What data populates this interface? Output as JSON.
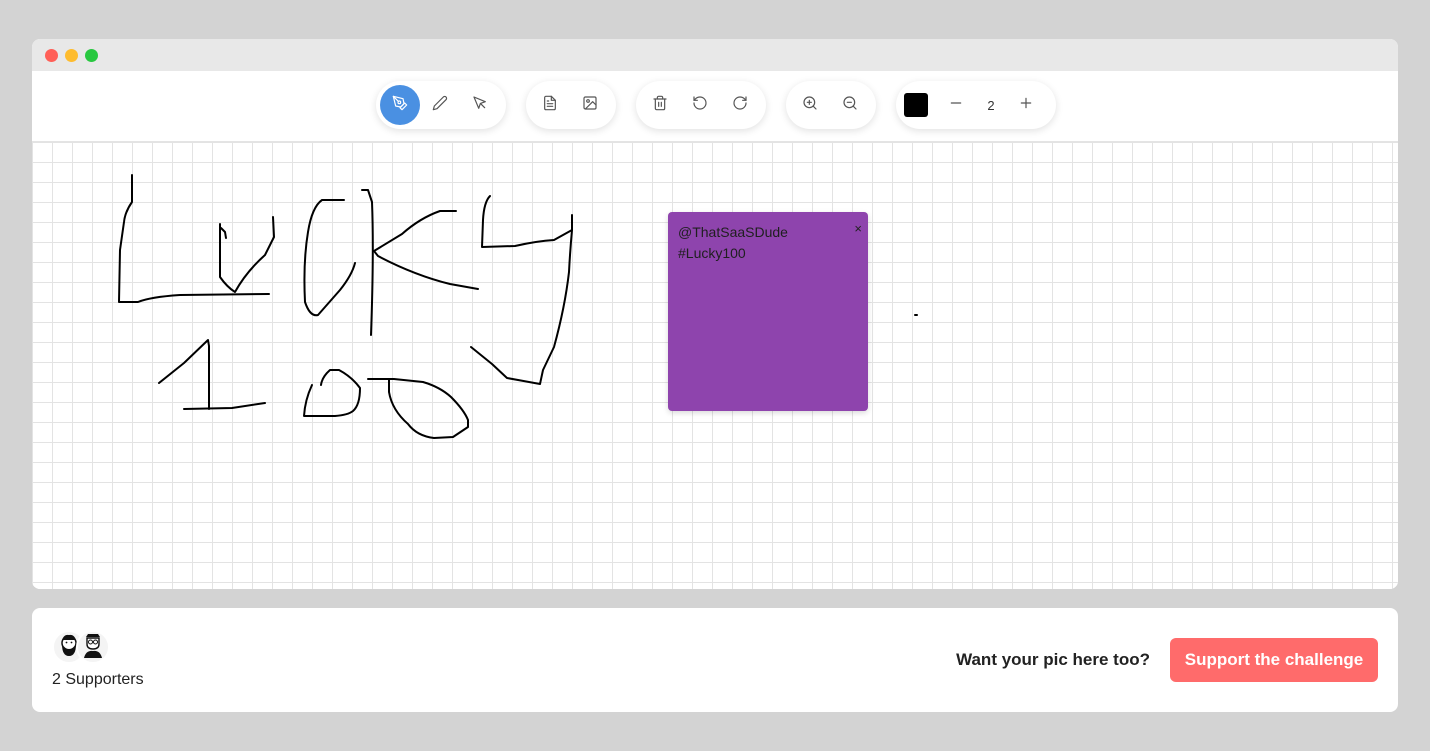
{
  "window": {
    "controls": [
      "close",
      "minimize",
      "maximize"
    ]
  },
  "toolbar": {
    "groups": [
      [
        {
          "name": "pen-tool",
          "icon": "pen-nib-icon",
          "active": true
        },
        {
          "name": "pencil-tool",
          "icon": "pencil-icon",
          "active": false
        },
        {
          "name": "select-tool",
          "icon": "cursor-arrow-icon",
          "active": false
        }
      ],
      [
        {
          "name": "add-note",
          "icon": "document-icon"
        },
        {
          "name": "add-image",
          "icon": "image-icon"
        }
      ],
      [
        {
          "name": "delete",
          "icon": "trash-icon"
        },
        {
          "name": "undo",
          "icon": "undo-icon"
        },
        {
          "name": "redo",
          "icon": "redo-icon"
        }
      ],
      [
        {
          "name": "zoom-in",
          "icon": "zoom-in-icon"
        },
        {
          "name": "zoom-out",
          "icon": "zoom-out-icon"
        }
      ]
    ],
    "color": "#000000",
    "stroke_width": "2",
    "accent": "#4a90e2"
  },
  "note": {
    "lines": [
      "@ThatSaaSDude",
      "#Lucky100"
    ],
    "close": "×",
    "color": "#8e44ad"
  },
  "footer": {
    "supporters_label": "2 Supporters",
    "cta_text": "Want your pic here too?",
    "cta_button": "Support the challenge",
    "button_color": "#ff6b6b"
  }
}
